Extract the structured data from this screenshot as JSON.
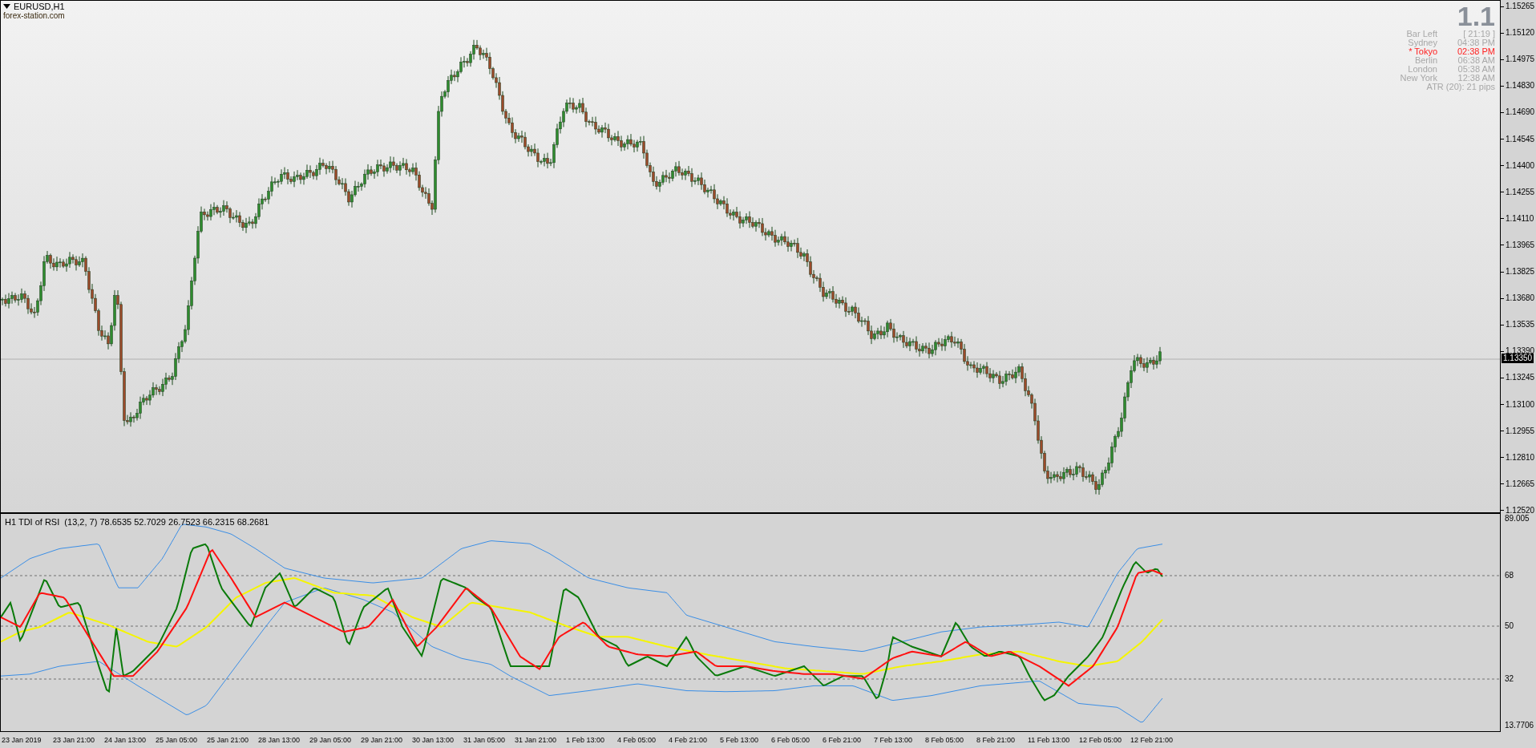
{
  "chart": {
    "symbol": "EURUSD,H1",
    "caption": "forex-station.com"
  },
  "info_panel": {
    "big_value": "1.1",
    "rows": [
      {
        "label": "Bar Left",
        "value": "[ 21:19 ]",
        "highlighted": false
      },
      {
        "label": "Sydney",
        "value": "04:38 PM",
        "highlighted": false
      },
      {
        "label": "* Tokyo",
        "value": "02:38 PM",
        "highlighted": true
      },
      {
        "label": "Berlin",
        "value": "06:38 AM",
        "highlighted": false
      },
      {
        "label": "London",
        "value": "05:38 AM",
        "highlighted": false
      },
      {
        "label": "New York",
        "value": "12:38 AM",
        "highlighted": false
      }
    ],
    "atr": "ATR (20): 21 pips"
  },
  "price_axis": {
    "ticks": [
      "1.15265",
      "1.15120",
      "1.14975",
      "1.14830",
      "1.14690",
      "1.14545",
      "1.14400",
      "1.14255",
      "1.14110",
      "1.13965",
      "1.13825",
      "1.13680",
      "1.13535",
      "1.13390",
      "1.13245",
      "1.13100",
      "1.12955",
      "1.12810",
      "1.12665",
      "1.12520"
    ],
    "current_price": "1.13350"
  },
  "indicator": {
    "title": "H1 TDI of RSI  (13,2, 7) 78.6535 52.7029 26.7523 66.2315 68.2681",
    "axis_ticks": [
      "89.005",
      "68",
      "50",
      "32",
      "13.7706"
    ]
  },
  "time_axis": {
    "labels": [
      "23 Jan 2019",
      "23 Jan 21:00",
      "24 Jan 13:00",
      "25 Jan 05:00",
      "25 Jan 21:00",
      "28 Jan 13:00",
      "29 Jan 05:00",
      "29 Jan 21:00",
      "30 Jan 13:00",
      "31 Jan 05:00",
      "31 Jan 21:00",
      "1 Feb 13:00",
      "4 Feb 05:00",
      "4 Feb 21:00",
      "5 Feb 13:00",
      "6 Feb 05:00",
      "6 Feb 21:00",
      "7 Feb 13:00",
      "8 Feb 05:00",
      "8 Feb 21:00",
      "11 Feb 13:00",
      "12 Feb 05:00",
      "12 Feb 21:00"
    ]
  }
}
